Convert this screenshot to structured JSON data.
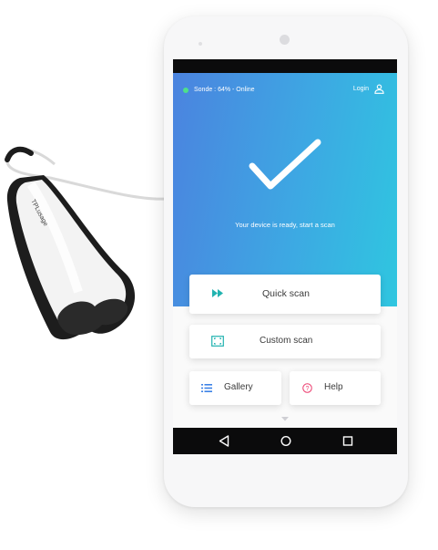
{
  "status": {
    "text": "Sonde : 64% - Online",
    "color": "#4ee08a"
  },
  "header": {
    "login_label": "Login"
  },
  "hero": {
    "message": "Your device is ready, start a scan",
    "gradient": [
      "#4b83df",
      "#2fc6e0"
    ]
  },
  "actions": {
    "quick_scan": {
      "label": "Quick scan",
      "icon": "fast-forward-icon",
      "color": "#22b3b0"
    },
    "custom_scan": {
      "label": "Custom scan",
      "icon": "crop-frame-icon",
      "color": "#22b3b0"
    },
    "gallery": {
      "label": "Gallery",
      "icon": "list-icon",
      "color": "#3b82e6"
    },
    "help": {
      "label": "Help",
      "icon": "help-circle-icon",
      "color": "#ec3b6d"
    }
  },
  "navigation": {
    "buttons": [
      "back-icon",
      "home-icon",
      "recents-icon"
    ]
  },
  "device": {
    "label": "TPLusage"
  }
}
